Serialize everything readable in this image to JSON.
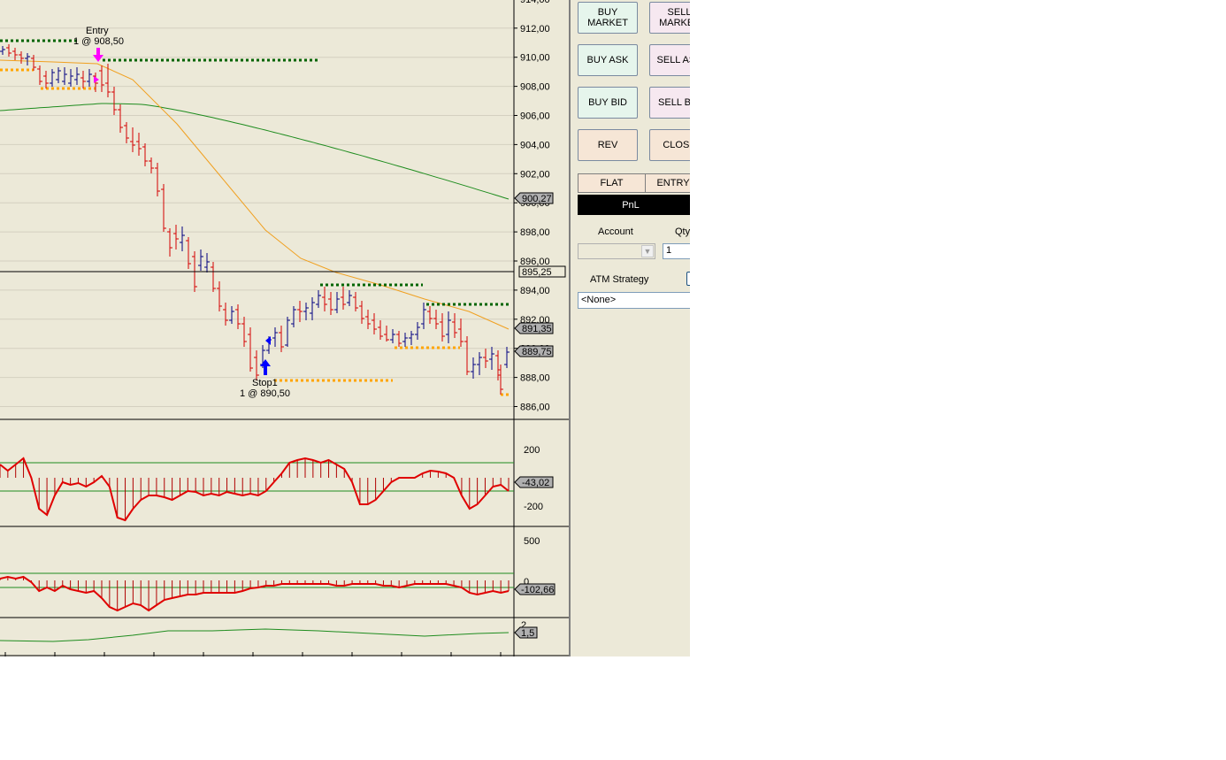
{
  "chart": {
    "price_axis": {
      "labels": [
        "914,00",
        "912,00",
        "910,00",
        "908,00",
        "906,00",
        "904,00",
        "902,00",
        "900,00",
        "898,00",
        "896,00",
        "894,00",
        "892,00",
        "890,00",
        "888,00",
        "886,00"
      ]
    },
    "price_markers": [
      {
        "label": "900,27",
        "kind": "gray"
      },
      {
        "label": "895,25",
        "kind": "line"
      },
      {
        "label": "891,35",
        "kind": "gray"
      },
      {
        "label": "889,75",
        "kind": "gray"
      }
    ],
    "annotations": {
      "entry_title": "Entry",
      "entry_detail": "1 @ 908,50",
      "stop_title": "Stop1",
      "stop_detail": "1 @ 890,50"
    },
    "cci_panel": {
      "labels": [
        "200",
        "-200"
      ],
      "value": "-43,02"
    },
    "panel3": {
      "labels": [
        "500",
        "0"
      ],
      "value": "-102,66"
    },
    "panel4": {
      "labels": [
        "2"
      ],
      "value": "1,5"
    },
    "colors": {
      "background": "#ece9d8",
      "up_bar": "#000080",
      "down_bar": "#d40000",
      "slow_ma": "#1e8c1e",
      "fast_ma": "#f0a020",
      "resistance": "#006400",
      "support": "#ffa500",
      "entry_arrow": "#ff00ff",
      "stop_arrow": "#0000ff"
    }
  },
  "order_panel": {
    "buttons": {
      "buy_market": "BUY\nMARKET",
      "sell_market": "SELL\nMARKET",
      "buy_ask": "BUY ASK",
      "sell_ask": "SELL ASK",
      "buy_bid": "BUY BID",
      "sell_bid": "SELL BID",
      "rev": "REV",
      "close": "CLOSE"
    },
    "position": {
      "flat": "FLAT",
      "entry": "ENTRY"
    },
    "pnl_label": "PnL",
    "account_label": "Account",
    "account_value": "",
    "qty_label": "Qty",
    "qty_value": "1",
    "atm_label": "ATM Strategy",
    "atm_value": "<None>"
  }
}
